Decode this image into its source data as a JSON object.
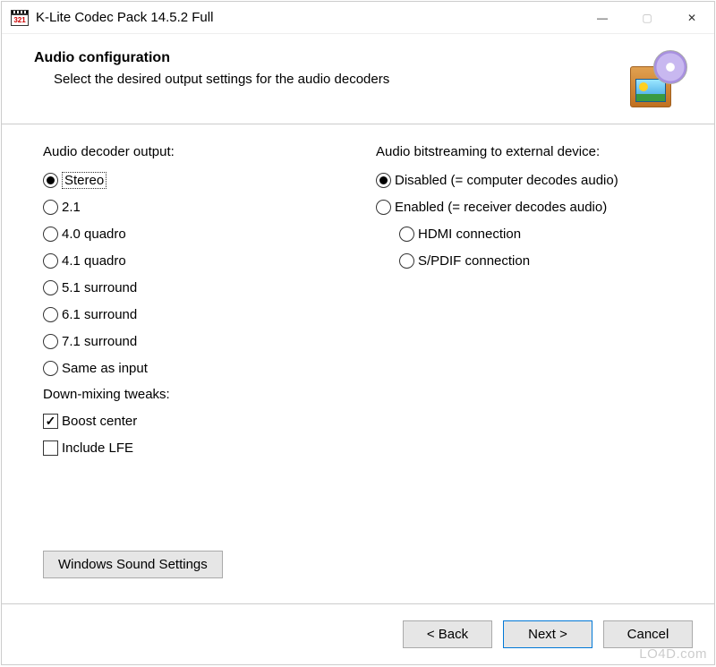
{
  "window": {
    "title": "K-Lite Codec Pack 14.5.2 Full",
    "app_icon_label": "321"
  },
  "header": {
    "title": "Audio configuration",
    "subtitle": "Select the desired output settings for the audio decoders"
  },
  "left": {
    "group_label": "Audio decoder output:",
    "options": [
      {
        "label": "Stereo",
        "selected": true,
        "focused": true
      },
      {
        "label": "2.1",
        "selected": false
      },
      {
        "label": "4.0 quadro",
        "selected": false
      },
      {
        "label": "4.1 quadro",
        "selected": false
      },
      {
        "label": "5.1 surround",
        "selected": false
      },
      {
        "label": "6.1 surround",
        "selected": false
      },
      {
        "label": "7.1 surround",
        "selected": false
      },
      {
        "label": "Same as input",
        "selected": false
      }
    ],
    "tweaks_label": "Down-mixing tweaks:",
    "tweaks": [
      {
        "label": "Boost center",
        "checked": true
      },
      {
        "label": "Include LFE",
        "checked": false
      }
    ]
  },
  "right": {
    "group_label": "Audio bitstreaming to external device:",
    "options": [
      {
        "label": "Disabled (= computer decodes audio)",
        "selected": true
      },
      {
        "label": "Enabled  (= receiver decodes audio)",
        "selected": false
      }
    ],
    "sub_options": [
      {
        "label": "HDMI connection",
        "selected": false
      },
      {
        "label": "S/PDIF connection",
        "selected": false
      }
    ]
  },
  "buttons": {
    "sound_settings": "Windows Sound Settings",
    "back": "< Back",
    "next": "Next >",
    "cancel": "Cancel"
  },
  "watermark": "LO4D.com"
}
